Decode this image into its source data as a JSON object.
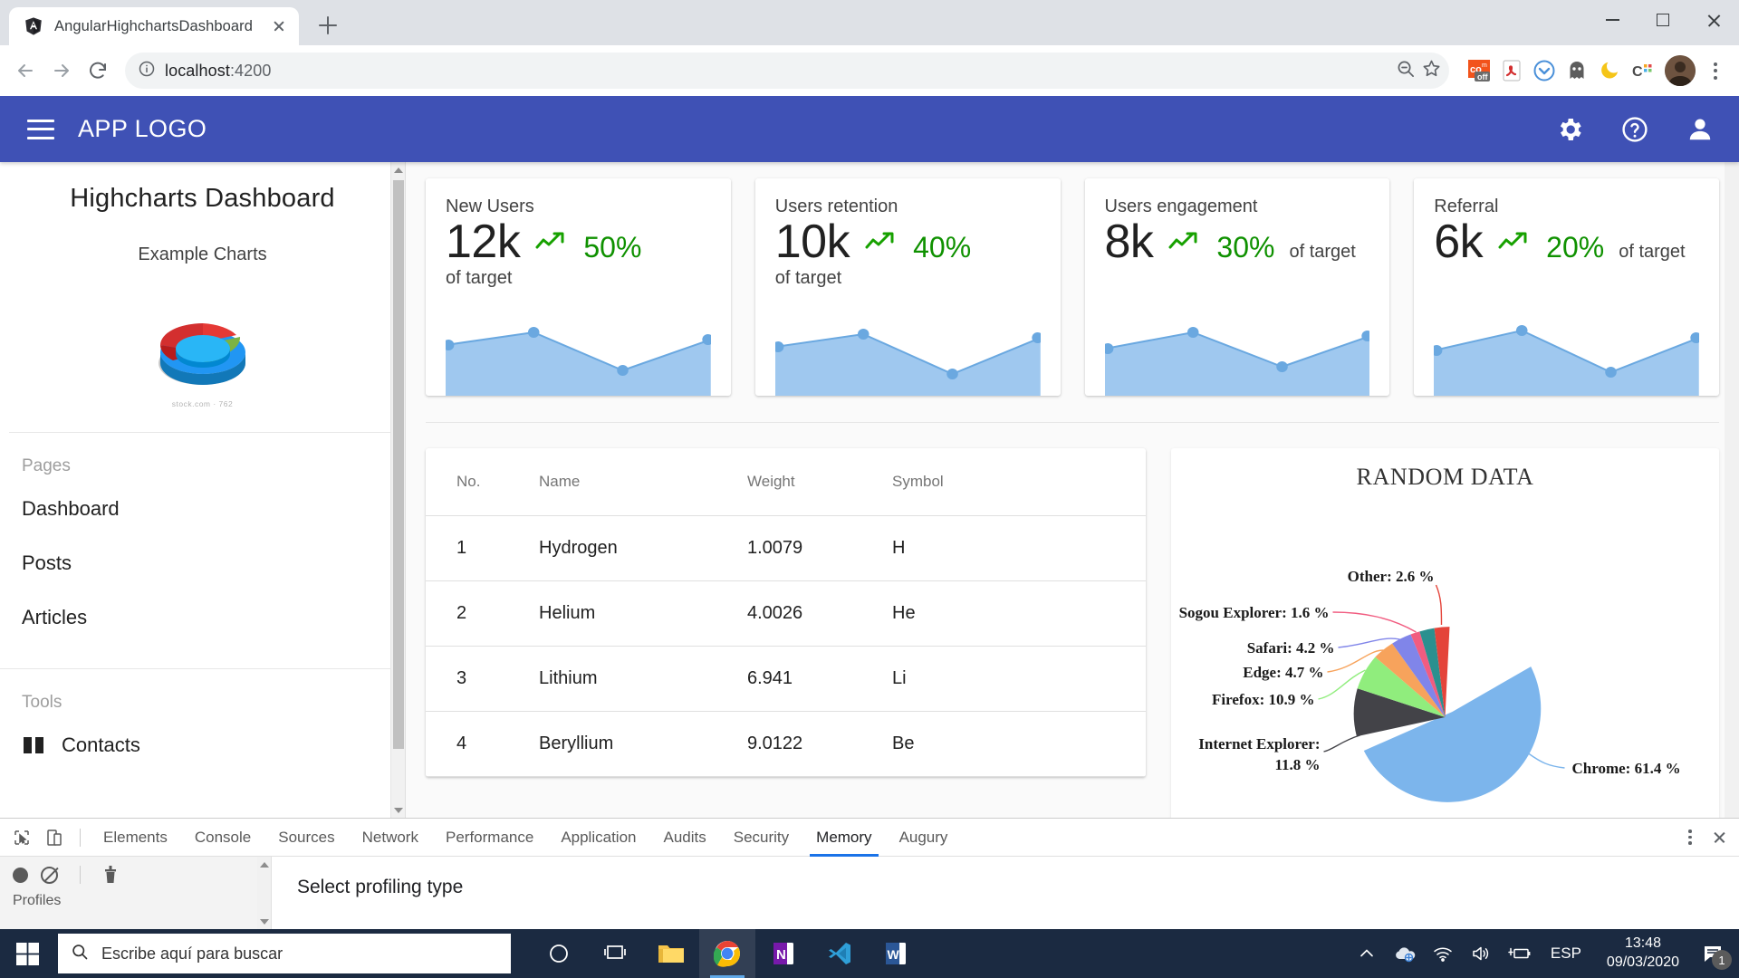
{
  "browser": {
    "tab": {
      "title": "AngularHighchartsDashboard",
      "favicon": "angular-logo-icon",
      "close_icon": "close-icon"
    },
    "new_tab_icon": "plus-icon",
    "window_controls": {
      "minimize": "minimize-icon",
      "maximize": "maximize-icon",
      "close": "close-icon"
    },
    "nav": {
      "back": "back-arrow-icon",
      "forward": "forward-arrow-icon",
      "reload": "reload-icon"
    },
    "omnibox": {
      "info_icon": "info-circle-icon",
      "url_host": "localhost",
      "url_port": ":4200",
      "zoom_out_icon": "zoom-out-icon",
      "bookmark_icon": "star-icon"
    },
    "extensions": [
      "colorzilla-icon",
      "adobe-acrobat-icon",
      "pocket-icon",
      "ghostery-icon",
      "nightmode-icon",
      "clickup-icon"
    ],
    "profile_avatar": "avatar",
    "menu_icon": "kebab-menu-icon"
  },
  "app": {
    "header": {
      "menu_icon": "hamburger-menu-icon",
      "logo": "APP LOGO",
      "settings_icon": "gear-icon",
      "help_icon": "help-circle-icon",
      "account_icon": "person-icon"
    },
    "sidebar": {
      "title": "Highcharts Dashboard",
      "subtitle": "Example Charts",
      "image": "pie-chart-3d-image",
      "watermark": "stock.com · 762",
      "sections": [
        {
          "label": "Pages",
          "items": [
            "Dashboard",
            "Posts",
            "Articles"
          ]
        },
        {
          "label": "Tools",
          "items": [
            "Contacts"
          ]
        }
      ],
      "scrollbar": {
        "up_icon": "scroll-up-arrow-icon",
        "down_icon": "scroll-down-arrow-icon"
      }
    },
    "kpi_cards": [
      {
        "label": "New Users",
        "value": "12k",
        "percent": "50%",
        "of_target": "of target",
        "trend_icon": "trend-up-icon",
        "spark": [
          0.62,
          0.78,
          0.22,
          0.5
        ]
      },
      {
        "label": "Users retention",
        "value": "10k",
        "percent": "40%",
        "of_target": "of target",
        "trend_icon": "trend-up-icon",
        "spark": [
          0.6,
          0.74,
          0.2,
          0.54
        ]
      },
      {
        "label": "Users engagement",
        "value": "8k",
        "percent": "30%",
        "of_target": "of target",
        "trend_icon": "trend-up-icon",
        "spark": [
          0.58,
          0.76,
          0.28,
          0.62
        ]
      },
      {
        "label": "Referral",
        "value": "6k",
        "percent": "20%",
        "of_target": "of target",
        "trend_icon": "trend-up-icon",
        "spark": [
          0.56,
          0.8,
          0.24,
          0.58
        ]
      }
    ],
    "table": {
      "columns": [
        "No.",
        "Name",
        "Weight",
        "Symbol"
      ],
      "rows": [
        [
          "1",
          "Hydrogen",
          "1.0079",
          "H"
        ],
        [
          "2",
          "Helium",
          "4.0026",
          "He"
        ],
        [
          "3",
          "Lithium",
          "6.941",
          "Li"
        ],
        [
          "4",
          "Beryllium",
          "9.0122",
          "Be"
        ]
      ]
    }
  },
  "chart_data": {
    "type": "pie",
    "title": "RANDOM DATA",
    "unit": "%",
    "legend_position": "none",
    "labels_outside": true,
    "categories": [
      "Chrome",
      "Internet Explorer",
      "Firefox",
      "Edge",
      "Safari",
      "Sogou Explorer",
      "Other"
    ],
    "values": [
      61.4,
      11.8,
      10.9,
      4.7,
      4.2,
      1.6,
      2.6
    ],
    "colors": [
      "#7cb5ec",
      "#434348",
      "#90ed7d",
      "#f7a35c",
      "#8085e9",
      "#f15c80",
      "#e4443a"
    ],
    "data_labels": [
      "Chrome: 61.4 %",
      "Internet Explorer: 11.8 %",
      "Firefox: 10.9 %",
      "Edge: 4.7 %",
      "Safari: 4.2 %",
      "Sogou Explorer: 1.6 %",
      "Other: 2.6 %"
    ],
    "sliced_slice": "Chrome"
  },
  "devtools": {
    "inspect_icon": "inspect-element-icon",
    "device_icon": "device-toolbar-icon",
    "tabs": [
      "Elements",
      "Console",
      "Sources",
      "Network",
      "Performance",
      "Application",
      "Audits",
      "Security",
      "Memory",
      "Augury"
    ],
    "active_tab": "Memory",
    "more_icon": "kebab-menu-icon",
    "close_icon": "close-icon",
    "record_icon": "record-icon",
    "clear_icon": "clear-icon",
    "trash_icon": "trash-icon",
    "profiles_label": "Profiles",
    "panel_heading": "Select profiling type"
  },
  "taskbar": {
    "start_icon": "windows-start-icon",
    "search_icon": "search-icon",
    "search_placeholder": "Escribe aquí para buscar",
    "apps": [
      "cortana-icon",
      "task-view-icon",
      "file-explorer-icon",
      "chrome-icon",
      "onenote-icon",
      "vscode-icon",
      "word-icon"
    ],
    "active_app": "chrome-icon",
    "tray": {
      "expand_icon": "chevron-up-icon",
      "onedrive_icon": "onedrive-icon",
      "network_icon": "wifi-icon",
      "volume_icon": "speaker-icon",
      "battery_icon": "battery-charging-icon",
      "language": "ESP"
    },
    "clock": {
      "time": "13:48",
      "date": "09/03/2020"
    },
    "notifications": {
      "icon": "action-center-icon",
      "count": "1"
    }
  }
}
